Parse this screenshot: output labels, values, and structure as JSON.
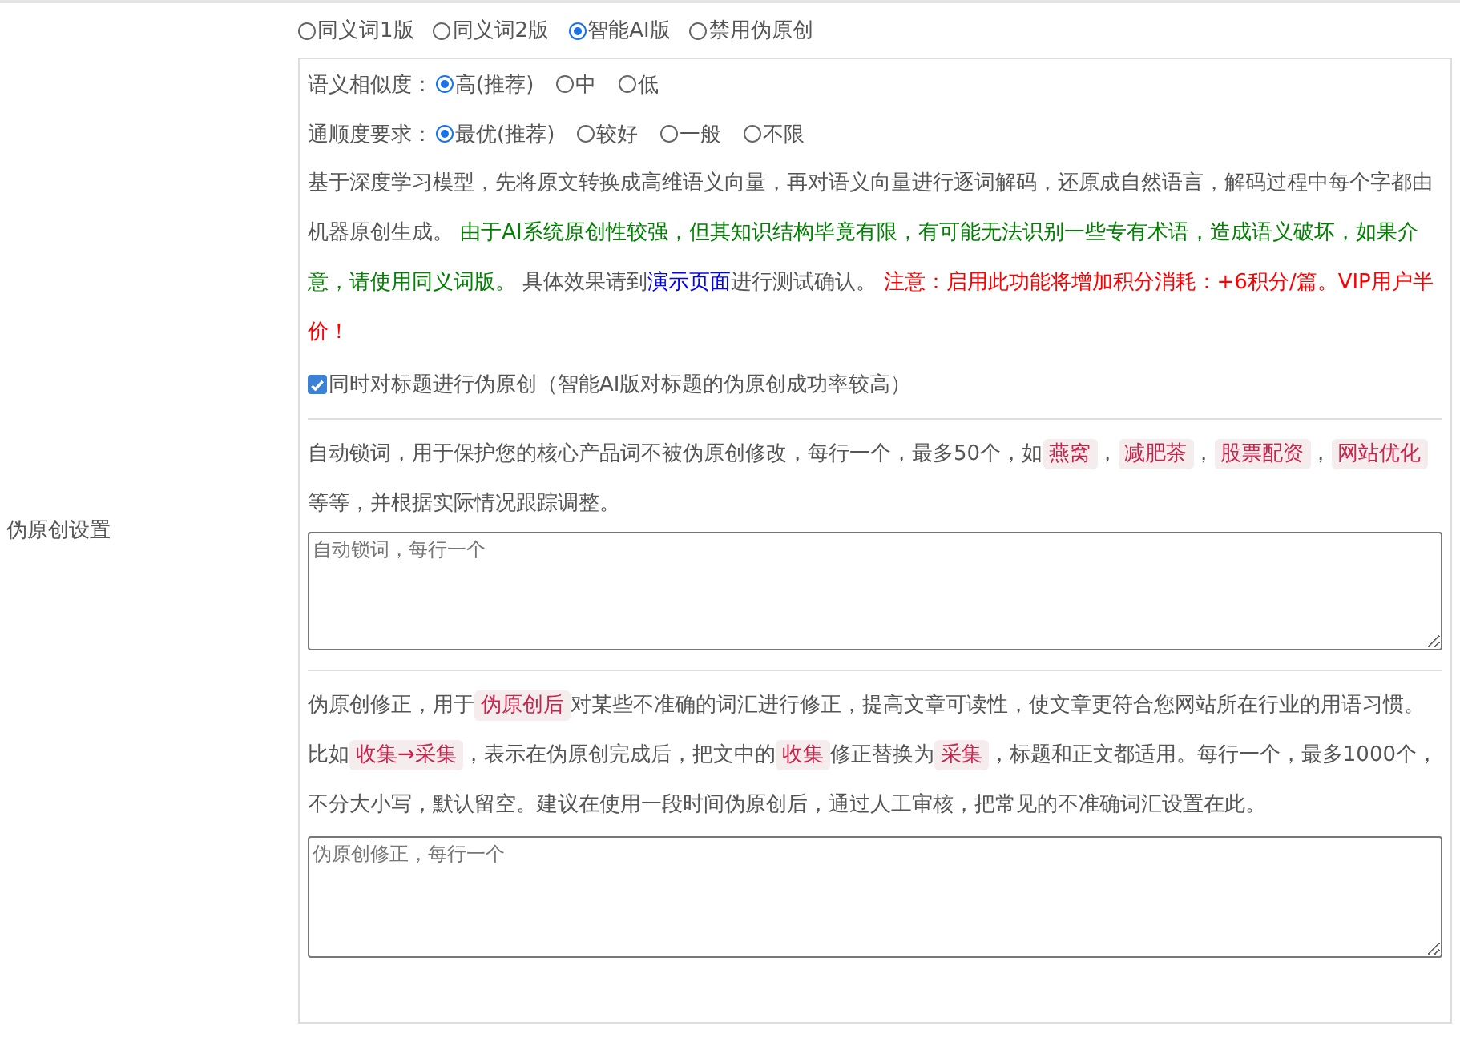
{
  "section_label": "伪原创设置",
  "modes": [
    {
      "label": "同义词1版",
      "selected": false
    },
    {
      "label": "同义词2版",
      "selected": false
    },
    {
      "label": "智能AI版",
      "selected": true
    },
    {
      "label": "禁用伪原创",
      "selected": false
    }
  ],
  "settings": [
    {
      "label": "语义相似度：",
      "options": [
        {
          "label": "高(推荐)",
          "selected": true
        },
        {
          "label": "中",
          "selected": false
        },
        {
          "label": "低",
          "selected": false
        }
      ]
    },
    {
      "label": "通顺度要求：",
      "options": [
        {
          "label": "最优(推荐)",
          "selected": true
        },
        {
          "label": "较好",
          "selected": false
        },
        {
          "label": "一般",
          "selected": false
        },
        {
          "label": "不限",
          "selected": false
        }
      ]
    }
  ],
  "description": [
    {
      "kind": "plain",
      "text": "基于深度学习模型，先将原文转换成高维语义向量，再对语义向量进行逐词解码，还原成自然语言，解码过程中每个字都由机器原创生成。 "
    },
    {
      "kind": "green",
      "text": "由于AI系统原创性较强，但其知识结构毕竟有限，有可能无法识别一些专有术语，造成语义破坏，如果介意，请使用同义词版。"
    },
    {
      "kind": "plain",
      "text": " 具体效果请到"
    },
    {
      "kind": "link",
      "text": "演示页面"
    },
    {
      "kind": "plain",
      "text": "进行测试确认。 "
    },
    {
      "kind": "red",
      "text": "注意：启用此功能将增加积分消耗：+6积分/篇。VIP用户半价！"
    }
  ],
  "title_option": {
    "label": "同时对标题进行伪原创（智能AI版对标题的伪原创成功率较高）",
    "checked": true
  },
  "lock_words": {
    "description": [
      {
        "kind": "plain",
        "text": "自动锁词，用于保护您的核心产品词不被伪原创修改，每行一个，最多50个，如"
      },
      {
        "kind": "tag",
        "text": "燕窝"
      },
      {
        "kind": "plain",
        "text": "，"
      },
      {
        "kind": "tag",
        "text": "减肥茶"
      },
      {
        "kind": "plain",
        "text": "，"
      },
      {
        "kind": "tag",
        "text": "股票配资"
      },
      {
        "kind": "plain",
        "text": "，"
      },
      {
        "kind": "tag",
        "text": "网站优化"
      },
      {
        "kind": "plain",
        "text": " 等等，并根据实际情况跟踪调整。"
      }
    ],
    "placeholder": "自动锁词，每行一个"
  },
  "corrections": {
    "description": [
      {
        "kind": "plain",
        "text": "伪原创修正，用于"
      },
      {
        "kind": "tag",
        "text": "伪原创后"
      },
      {
        "kind": "plain",
        "text": "对某些不准确的词汇进行修正，提高文章可读性，使文章更符合您网站所在行业的用语习惯。比如"
      },
      {
        "kind": "tag",
        "text": "收集→采集"
      },
      {
        "kind": "plain",
        "text": "，表示在伪原创完成后，把文中的"
      },
      {
        "kind": "tag",
        "text": "收集"
      },
      {
        "kind": "plain",
        "text": "修正替换为"
      },
      {
        "kind": "tag",
        "text": "采集"
      },
      {
        "kind": "plain",
        "text": "，标题和正文都适用。每行一个，最多1000个，不分大小写，默认留空。建议在使用一段时间伪原创后，通过人工审核，把常见的不准确词汇设置在此。"
      }
    ],
    "placeholder": "伪原创修正，每行一个"
  }
}
